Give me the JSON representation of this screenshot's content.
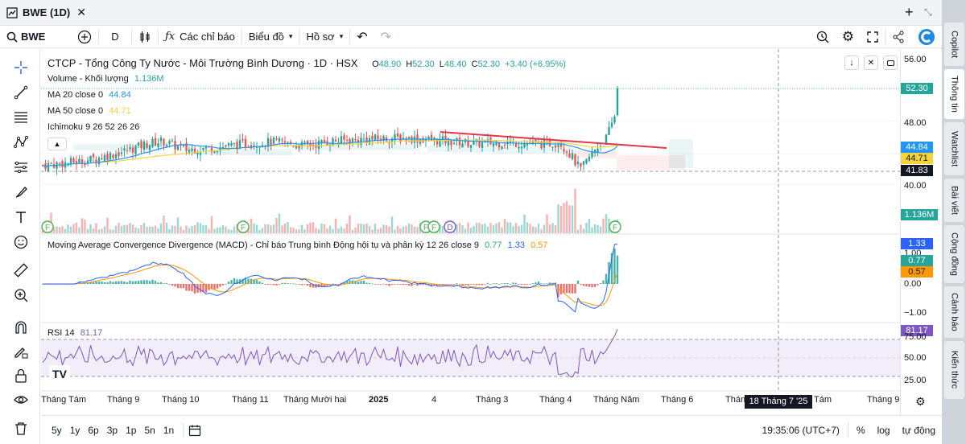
{
  "window": {
    "title": "BWE (1D)"
  },
  "toolbar": {
    "symbol": "BWE",
    "interval": "D",
    "indicators": "Các chỉ báo",
    "chart_layout": "Biểu đồ",
    "profile": "Hồ sơ"
  },
  "legend": {
    "main_title": "CTCP - Tổng Công Ty Nước - Môi Trường Bình Dương · 1D · HSX",
    "o_label": "O",
    "o": "48.90",
    "h_label": "H",
    "h": "52.30",
    "l_label": "L",
    "l": "48.40",
    "c_label": "C",
    "c": "52.30",
    "change": "+3.40 (+6.95%)",
    "volume_label": "Volume - Khối lượng",
    "volume": "1.136M",
    "ma20_label": "MA 20 close 0",
    "ma20": "44.84",
    "ma50_label": "MA 50 close 0",
    "ma50": "44.71",
    "ichimoku": "Ichimoku 9 26 52 26 26",
    "macd_label": "Moving Average Convergence Divergence (MACD) - Chỉ báo Trung bình Động hội tụ và phân kỳ 12 26 close 9",
    "macd_hist": "0.77",
    "macd": "1.33",
    "macd_signal": "0.57",
    "rsi_label": "RSI 14",
    "rsi": "81.17"
  },
  "price_scale": {
    "main_ticks": [
      "56.00",
      "48.00",
      "40.00"
    ],
    "tags": {
      "last": "52.30",
      "ma20": "44.84",
      "ma50": "44.71",
      "crosshair": "41.83",
      "volume": "1.136M"
    },
    "macd_ticks": [
      "1.00",
      "0.00",
      "−1.00"
    ],
    "macd_tags": {
      "macd": "1.33",
      "hist": "0.77",
      "signal": "0.57"
    },
    "rsi_ticks": [
      "75.00",
      "50.00",
      "25.00"
    ],
    "rsi_tag": "81.17"
  },
  "time_axis": {
    "labels": [
      "Tháng Tám",
      "Tháng 9",
      "Tháng 10",
      "Tháng 11",
      "Tháng Mười hai",
      "2025",
      "4",
      "Tháng 3",
      "Tháng 4",
      "Tháng Năm",
      "Tháng 6",
      "Thán",
      "Tám",
      "Tháng 9"
    ],
    "crosshair": "18 Tháng 7 '25"
  },
  "events": {
    "dividend": "F",
    "split": "D"
  },
  "bottom": {
    "ranges": [
      "5y",
      "1y",
      "6p",
      "3p",
      "1p",
      "5n",
      "1n"
    ],
    "clock": "19:35:06 (UTC+7)",
    "percent": "%",
    "log": "log",
    "auto": "tự động"
  },
  "right_tabs": [
    "Copilot",
    "Thông tin",
    "Watchlist",
    "Bài viết",
    "Cộng đồng",
    "Cảnh báo",
    "Kiến thức"
  ],
  "colors": {
    "up": "#26a69a",
    "down": "#ef5350",
    "ma20": "#2196f3",
    "ma50": "#f5d33b",
    "trend": "#e5364b",
    "rsi": "#7e57c2",
    "tag_dark": "#131722"
  },
  "chart_data": {
    "type": "candlestick",
    "title": "CTCP - Tổng Công Ty Nước - Môi Trường Bình Dương · 1D · HSX",
    "approx_close_path": [
      [
        0,
        42.5
      ],
      [
        30,
        42.8
      ],
      [
        60,
        43.2
      ],
      [
        100,
        44.2
      ],
      [
        130,
        45.2
      ],
      [
        150,
        45.6
      ],
      [
        180,
        44.5
      ],
      [
        220,
        44.8
      ],
      [
        250,
        45.2
      ],
      [
        290,
        45.5
      ],
      [
        330,
        45.0
      ],
      [
        360,
        45.6
      ],
      [
        400,
        45.8
      ],
      [
        450,
        46.0
      ],
      [
        490,
        45.7
      ],
      [
        540,
        45.3
      ],
      [
        580,
        45.4
      ],
      [
        620,
        45.2
      ],
      [
        645,
        45.4
      ],
      [
        660,
        43.5
      ],
      [
        670,
        41.9
      ],
      [
        690,
        44.8
      ],
      [
        700,
        45.5
      ],
      [
        712,
        48.5
      ],
      [
        717,
        52.3
      ]
    ],
    "last": {
      "open": 48.9,
      "high": 52.3,
      "low": 48.4,
      "close": 52.3
    },
    "ma20_last": 44.84,
    "ma50_last": 44.71,
    "ylim": [
      38,
      57
    ],
    "macd": {
      "macd": 1.33,
      "signal": 0.57,
      "hist": 0.77,
      "ylim": [
        -1.6,
        1.6
      ]
    },
    "rsi": {
      "value": 81.17,
      "bands": [
        30,
        70
      ],
      "ylim": [
        20,
        85
      ]
    }
  }
}
